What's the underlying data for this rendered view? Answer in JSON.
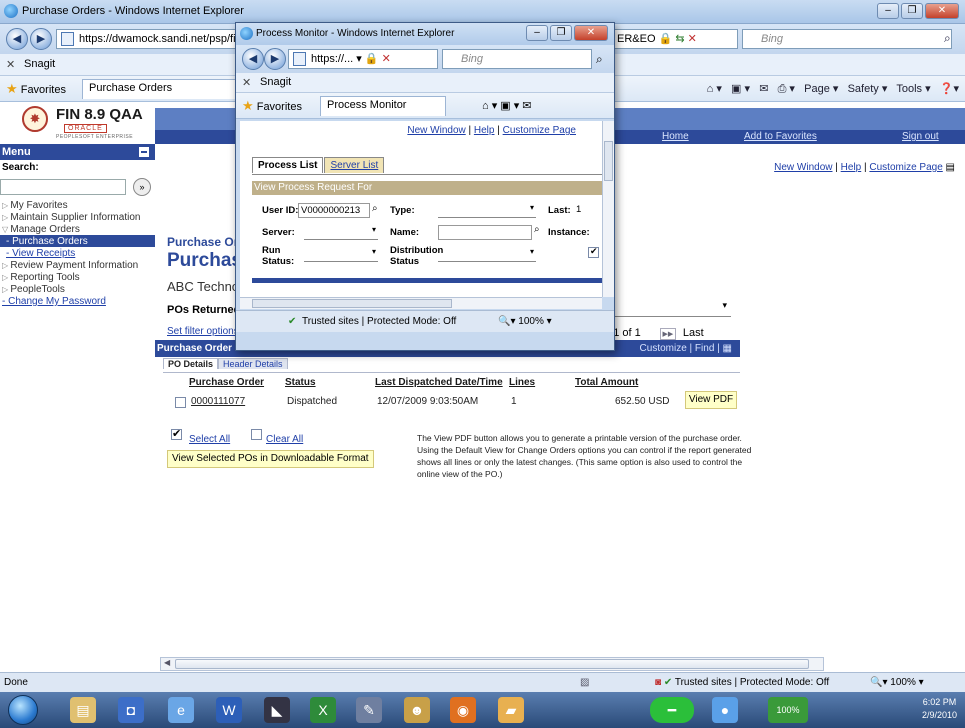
{
  "main_window": {
    "title": "Purchase Orders - Windows Internet Explorer",
    "url": "https://dwamock.sandi.net/psp/fin89",
    "url_tail": "ER&EO",
    "search_placeholder": "Bing",
    "links_bar_item": "Snagit",
    "favorites_label": "Favorites",
    "tab_label": "Purchase Orders",
    "command_bar": [
      "Page ▾",
      "Safety ▾",
      "Tools ▾"
    ]
  },
  "ps_header": {
    "product": "FIN 8.9 QAA",
    "oracle": "ORACLE",
    "peoplesoft": "PEOPLESOFT ENTERPRISE",
    "links": [
      "Home",
      "Add to Favorites",
      "Sign out"
    ]
  },
  "sidebar": {
    "menu_label": "Menu",
    "search_label": "Search:",
    "go_label": "»",
    "items": [
      {
        "label": "My Favorites"
      },
      {
        "label": "Maintain Supplier Information"
      },
      {
        "label": "Manage Orders"
      },
      {
        "label": "- Purchase Orders"
      },
      {
        "label": "- View Receipts"
      },
      {
        "label": "Review Payment Information"
      },
      {
        "label": "Reporting Tools"
      },
      {
        "label": "PeopleTools"
      },
      {
        "label": "- Change My Password"
      }
    ]
  },
  "content": {
    "top_links": [
      "New Window",
      "Help",
      "Customize Page"
    ],
    "breadcrumb": "Purchase Orde",
    "title": "Purchase (",
    "business_unit": "ABC Technolog",
    "pos_returned_label": "POs Returned:",
    "filter_link": "Set filter options",
    "control_value": "s",
    "pager_text": "to 1 of 1",
    "pager_last": "Last",
    "grid_title": "Purchase Order Lis",
    "grid_customize": "Customize | Find |",
    "tabs": [
      "PO Details",
      "Header Details"
    ],
    "columns": [
      "Purchase Order",
      "Status",
      "Last Dispatched Date/Time",
      "Lines",
      "Total Amount"
    ],
    "rows": [
      {
        "po": "0000111077",
        "status": "Dispatched",
        "dispatched": "12/07/2009 9:03:50AM",
        "lines": "1",
        "amount": "652.50 USD"
      }
    ],
    "view_pdf": "View PDF",
    "select_all": "Select All",
    "clear_all": "Clear All",
    "download_button": "View Selected POs in Downloadable Format",
    "help_text": "The View PDF button allows you to generate a printable version of the purchase order. Using the Default View for Change Orders options you can control if the report generated shows all lines or only the latest changes. (This same option is also used to control the online view of the PO.)"
  },
  "popup": {
    "title": "Process Monitor - Windows Internet Explorer",
    "url": "https://...",
    "search_placeholder": "Bing",
    "links_bar_item": "Snagit",
    "favorites_label": "Favorites",
    "tab_label": "Process Monitor",
    "top_links": [
      "New Window",
      "Help",
      "Customize Page"
    ],
    "tabs": [
      "Process List",
      "Server List"
    ],
    "section": "View Process Request For",
    "fields": {
      "user_id_label": "User ID:",
      "user_id_value": "V0000000213",
      "type_label": "Type:",
      "last_label": "Last:",
      "last_value": "1",
      "server_label": "Server:",
      "name_label": "Name:",
      "instance_label": "Instance:",
      "run_status_label": "Run Status:",
      "dist_status_label": "Distribution Status"
    },
    "status_text": "Trusted sites | Protected Mode: Off",
    "zoom": "100%"
  },
  "statusbar": {
    "left": "Done",
    "zone": "Trusted sites | Protected Mode: Off",
    "zoom": "100%"
  },
  "taskbar": {
    "battery": "100%",
    "time": "6:02 PM",
    "date": "2/9/2010"
  },
  "colors": {
    "ps_blue": "#2d4a9a",
    "banner_blue": "#5d7fc3",
    "link": "#1f3fa8",
    "button_yellow": "#ffffc8"
  }
}
